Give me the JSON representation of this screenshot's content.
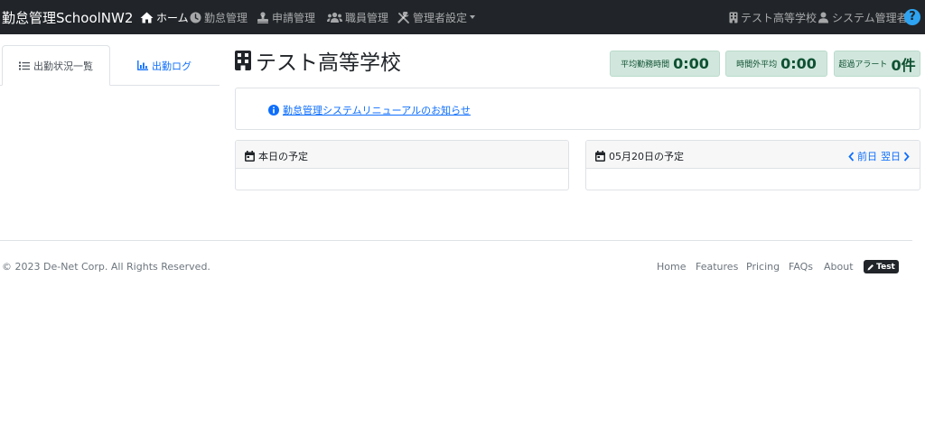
{
  "navbar": {
    "brand": "勤怠管理SchoolNW2",
    "items": [
      {
        "label": "ホーム"
      },
      {
        "label": "勤怠管理"
      },
      {
        "label": "申請管理"
      },
      {
        "label": "職員管理"
      },
      {
        "label": "管理者設定"
      }
    ],
    "school": "テスト高等学校",
    "user": "システム管理者",
    "help": "?"
  },
  "tabs": [
    {
      "label": "出勤状況一覧",
      "active": true
    },
    {
      "label": "出勤ログ",
      "active": false
    }
  ],
  "page": {
    "title": "テスト高等学校"
  },
  "stats": [
    {
      "label": "平均勤務時間",
      "value": "0:00"
    },
    {
      "label": "時間外平均",
      "value": "0:00"
    },
    {
      "label": "超過アラート",
      "value": "0件"
    }
  ],
  "notice": {
    "link_text": "勤怠管理システムリニューアルのお知らせ"
  },
  "cards": {
    "today": {
      "title": "本日の予定"
    },
    "next": {
      "title": "05月20日の予定",
      "prev": "前日",
      "following": "翌日"
    }
  },
  "footer": {
    "copyright": "© 2023 De-Net Corp. All Rights Reserved.",
    "links": [
      "Home",
      "Features",
      "Pricing",
      "FAQs",
      "About"
    ],
    "badge": "Test"
  },
  "colors": {
    "navbar_bg": "#212529",
    "accent": "#0d6efd",
    "stat_bg": "#d1e7dd",
    "stat_text": "#0f5132",
    "help_bg": "#2ea3f2"
  }
}
